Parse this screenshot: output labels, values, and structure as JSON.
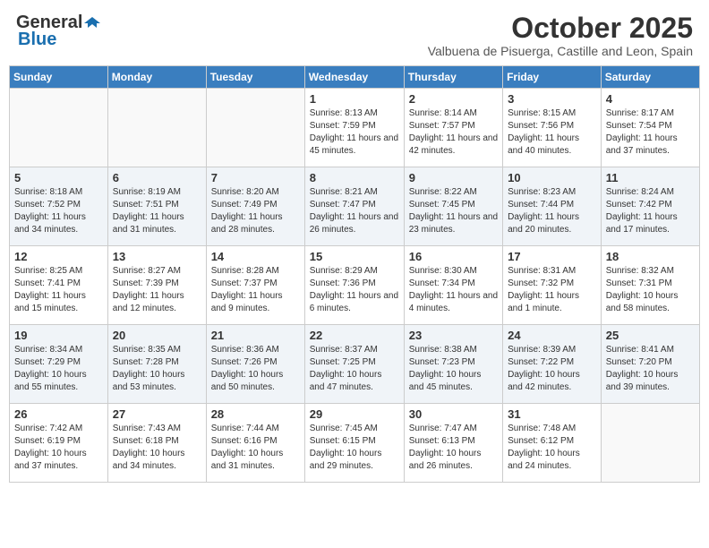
{
  "header": {
    "logo_general": "General",
    "logo_blue": "Blue",
    "month_title": "October 2025",
    "subtitle": "Valbuena de Pisuerga, Castille and Leon, Spain"
  },
  "weekdays": [
    "Sunday",
    "Monday",
    "Tuesday",
    "Wednesday",
    "Thursday",
    "Friday",
    "Saturday"
  ],
  "weeks": [
    [
      {
        "day": "",
        "info": ""
      },
      {
        "day": "",
        "info": ""
      },
      {
        "day": "",
        "info": ""
      },
      {
        "day": "1",
        "info": "Sunrise: 8:13 AM\nSunset: 7:59 PM\nDaylight: 11 hours and 45 minutes."
      },
      {
        "day": "2",
        "info": "Sunrise: 8:14 AM\nSunset: 7:57 PM\nDaylight: 11 hours and 42 minutes."
      },
      {
        "day": "3",
        "info": "Sunrise: 8:15 AM\nSunset: 7:56 PM\nDaylight: 11 hours and 40 minutes."
      },
      {
        "day": "4",
        "info": "Sunrise: 8:17 AM\nSunset: 7:54 PM\nDaylight: 11 hours and 37 minutes."
      }
    ],
    [
      {
        "day": "5",
        "info": "Sunrise: 8:18 AM\nSunset: 7:52 PM\nDaylight: 11 hours and 34 minutes."
      },
      {
        "day": "6",
        "info": "Sunrise: 8:19 AM\nSunset: 7:51 PM\nDaylight: 11 hours and 31 minutes."
      },
      {
        "day": "7",
        "info": "Sunrise: 8:20 AM\nSunset: 7:49 PM\nDaylight: 11 hours and 28 minutes."
      },
      {
        "day": "8",
        "info": "Sunrise: 8:21 AM\nSunset: 7:47 PM\nDaylight: 11 hours and 26 minutes."
      },
      {
        "day": "9",
        "info": "Sunrise: 8:22 AM\nSunset: 7:45 PM\nDaylight: 11 hours and 23 minutes."
      },
      {
        "day": "10",
        "info": "Sunrise: 8:23 AM\nSunset: 7:44 PM\nDaylight: 11 hours and 20 minutes."
      },
      {
        "day": "11",
        "info": "Sunrise: 8:24 AM\nSunset: 7:42 PM\nDaylight: 11 hours and 17 minutes."
      }
    ],
    [
      {
        "day": "12",
        "info": "Sunrise: 8:25 AM\nSunset: 7:41 PM\nDaylight: 11 hours and 15 minutes."
      },
      {
        "day": "13",
        "info": "Sunrise: 8:27 AM\nSunset: 7:39 PM\nDaylight: 11 hours and 12 minutes."
      },
      {
        "day": "14",
        "info": "Sunrise: 8:28 AM\nSunset: 7:37 PM\nDaylight: 11 hours and 9 minutes."
      },
      {
        "day": "15",
        "info": "Sunrise: 8:29 AM\nSunset: 7:36 PM\nDaylight: 11 hours and 6 minutes."
      },
      {
        "day": "16",
        "info": "Sunrise: 8:30 AM\nSunset: 7:34 PM\nDaylight: 11 hours and 4 minutes."
      },
      {
        "day": "17",
        "info": "Sunrise: 8:31 AM\nSunset: 7:32 PM\nDaylight: 11 hours and 1 minute."
      },
      {
        "day": "18",
        "info": "Sunrise: 8:32 AM\nSunset: 7:31 PM\nDaylight: 10 hours and 58 minutes."
      }
    ],
    [
      {
        "day": "19",
        "info": "Sunrise: 8:34 AM\nSunset: 7:29 PM\nDaylight: 10 hours and 55 minutes."
      },
      {
        "day": "20",
        "info": "Sunrise: 8:35 AM\nSunset: 7:28 PM\nDaylight: 10 hours and 53 minutes."
      },
      {
        "day": "21",
        "info": "Sunrise: 8:36 AM\nSunset: 7:26 PM\nDaylight: 10 hours and 50 minutes."
      },
      {
        "day": "22",
        "info": "Sunrise: 8:37 AM\nSunset: 7:25 PM\nDaylight: 10 hours and 47 minutes."
      },
      {
        "day": "23",
        "info": "Sunrise: 8:38 AM\nSunset: 7:23 PM\nDaylight: 10 hours and 45 minutes."
      },
      {
        "day": "24",
        "info": "Sunrise: 8:39 AM\nSunset: 7:22 PM\nDaylight: 10 hours and 42 minutes."
      },
      {
        "day": "25",
        "info": "Sunrise: 8:41 AM\nSunset: 7:20 PM\nDaylight: 10 hours and 39 minutes."
      }
    ],
    [
      {
        "day": "26",
        "info": "Sunrise: 7:42 AM\nSunset: 6:19 PM\nDaylight: 10 hours and 37 minutes."
      },
      {
        "day": "27",
        "info": "Sunrise: 7:43 AM\nSunset: 6:18 PM\nDaylight: 10 hours and 34 minutes."
      },
      {
        "day": "28",
        "info": "Sunrise: 7:44 AM\nSunset: 6:16 PM\nDaylight: 10 hours and 31 minutes."
      },
      {
        "day": "29",
        "info": "Sunrise: 7:45 AM\nSunset: 6:15 PM\nDaylight: 10 hours and 29 minutes."
      },
      {
        "day": "30",
        "info": "Sunrise: 7:47 AM\nSunset: 6:13 PM\nDaylight: 10 hours and 26 minutes."
      },
      {
        "day": "31",
        "info": "Sunrise: 7:48 AM\nSunset: 6:12 PM\nDaylight: 10 hours and 24 minutes."
      },
      {
        "day": "",
        "info": ""
      }
    ]
  ]
}
